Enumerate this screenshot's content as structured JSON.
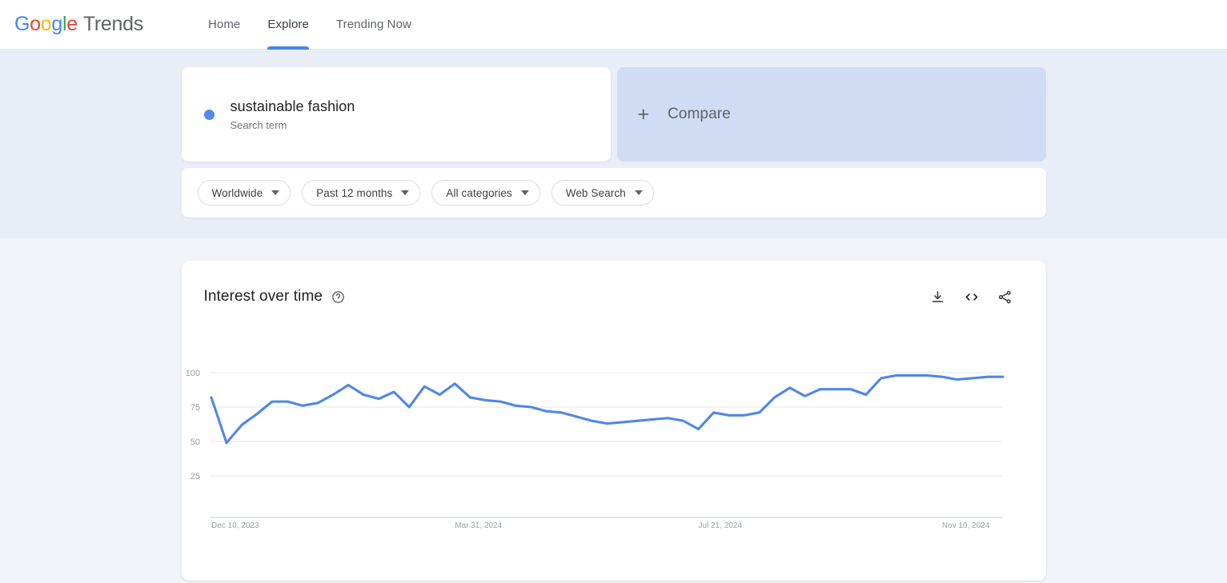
{
  "header": {
    "logo": {
      "word": "Google",
      "suffix": "Trends"
    },
    "nav": [
      {
        "label": "Home",
        "active": false
      },
      {
        "label": "Explore",
        "active": true
      },
      {
        "label": "Trending Now",
        "active": false
      }
    ]
  },
  "query": {
    "term": {
      "title": "sustainable fashion",
      "subtitle": "Search term",
      "dot_color": "#5587ed"
    },
    "compare": {
      "plus": "+",
      "label": "Compare"
    },
    "filters": [
      {
        "label": "Worldwide",
        "name": "location"
      },
      {
        "label": "Past 12 months",
        "name": "time-range"
      },
      {
        "label": "All categories",
        "name": "category"
      },
      {
        "label": "Web Search",
        "name": "search-type"
      }
    ]
  },
  "chart_card": {
    "title": "Interest over time",
    "help_icon": "question-mark-circle",
    "actions": [
      {
        "name": "download-icon",
        "glyph": "download"
      },
      {
        "name": "embed-icon",
        "glyph": "<>"
      },
      {
        "name": "share-icon",
        "glyph": "share"
      }
    ]
  },
  "chart_data": {
    "type": "line",
    "title": "Interest over time",
    "xlabel": "",
    "ylabel": "",
    "ylim": [
      0,
      110
    ],
    "grid": true,
    "legend": false,
    "line_color": "#4f86e8",
    "y_ticks": [
      100,
      75,
      50,
      25
    ],
    "x_ticks": [
      "Dec 10, 2023",
      "Mar 31, 2024",
      "Jul 21, 2024",
      "Nov 10, 2024"
    ],
    "x_tick_indices": [
      0,
      16,
      32,
      48
    ],
    "series": [
      {
        "name": "sustainable fashion",
        "values": [
          82,
          49,
          62,
          70,
          79,
          79,
          76,
          78,
          84,
          91,
          84,
          81,
          86,
          75,
          90,
          84,
          92,
          82,
          80,
          79,
          76,
          75,
          72,
          71,
          68,
          65,
          63,
          64,
          65,
          66,
          67,
          65,
          59,
          71,
          69,
          69,
          71,
          82,
          89,
          83,
          88,
          88,
          88,
          84,
          96,
          98,
          98,
          98,
          97,
          95,
          96,
          97,
          97
        ]
      }
    ]
  }
}
